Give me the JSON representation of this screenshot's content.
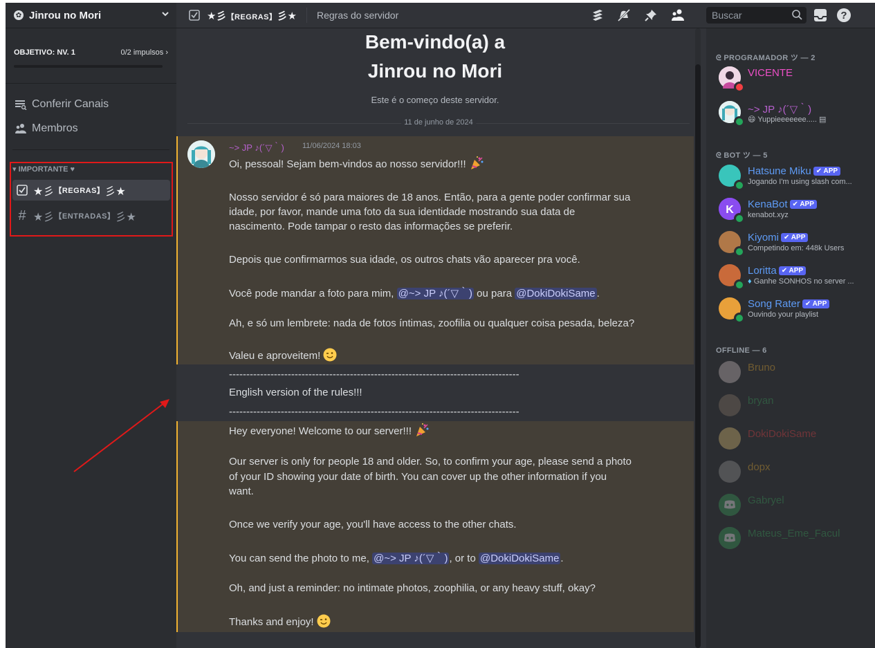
{
  "sidebar": {
    "server_name": "Jinrou no Mori",
    "boost": {
      "goal": "OBJETIVO: NV. 1",
      "count": "0/2 impulsos",
      "progress": 0.0
    },
    "nav": [
      {
        "label": "Conferir Canais",
        "icon": "channel-list-icon"
      },
      {
        "label": "Membros",
        "icon": "members-icon"
      }
    ],
    "category": "▾ IMPORTANTE ♥",
    "channels": [
      {
        "prefix": "★彡",
        "name": "【REGRAS】",
        "suffix": "彡★",
        "icon": "rules-icon",
        "selected": true
      },
      {
        "prefix": "★彡",
        "name": "【ENTRADAS】",
        "suffix": "彡★",
        "icon": "hash-icon",
        "selected": false
      }
    ]
  },
  "topbar": {
    "channel_prefix": "★彡",
    "channel_name": "【REGRAS】",
    "channel_suffix": "彡★",
    "topic": "Regras do servidor",
    "search_placeholder": "Buscar"
  },
  "main": {
    "welcome_line1": "Bem-vindo(a) a",
    "welcome_line2": "Jinrou no Mori",
    "welcome_sub": "Este é o começo deste servidor.",
    "date_divider": "11 de junho de 2024",
    "message": {
      "author": "~> JP ♪(´▽｀)",
      "timestamp": "11/06/2024 18:03",
      "pt": {
        "l1": "Oi, pessoal! Sejam bem-vindos ao nosso servidor!!!",
        "l2": "Nosso servidor é só para maiores de 18 anos. Então, para a gente poder confirmar sua",
        "l3": "idade, por favor, mande uma foto da sua identidade mostrando sua data de",
        "l4": "nascimento. Pode tampar o resto das informações se preferir.",
        "l5": "Depois que confirmarmos sua idade, os outros chats vão aparecer pra você.",
        "l6_pre": "Você pode mandar a foto para mim,",
        "l6_m1": "@~> JP ♪(´▽｀)",
        "l6_mid": "ou para",
        "l6_m2": "@DokiDokiSame",
        "l6_post": ".",
        "l7": "Ah, e só um lembrete: nada de fotos íntimas, zoofilia ou qualquer coisa pesada, beleza?",
        "l8": "Valeu e aproveitem!"
      },
      "divider": "------------------------------------------------------------------------------------",
      "english_header": "English version of the rules!!!",
      "en": {
        "l1": "Hey everyone! Welcome to our server!!!",
        "l2": "Our server is only for people 18 and older. So, to confirm your age, please send a photo",
        "l3": "of your ID showing your date of birth. You can cover up the other information if you",
        "l4": "want.",
        "l5": "Once we verify your age, you'll have access to the other chats.",
        "l6_pre": "You can send the photo to me,",
        "l6_m1": "@~> JP ♪(´▽｀)",
        "l6_mid": ", or to",
        "l6_m2": "@DokiDokiSame",
        "l6_post": ".",
        "l7": "Oh, and just a reminder: no intimate photos, zoophilia, or any heavy stuff, okay?",
        "l8": "Thanks and enjoy!"
      }
    }
  },
  "members": {
    "groups": [
      {
        "label": "ᘓ PROGRAMADOR ツ — 2"
      },
      {
        "label": "ᘓ BOT ツ — 5"
      },
      {
        "label": "OFFLINE — 6"
      }
    ],
    "programadores": [
      {
        "name": "VICENTE",
        "activity": "",
        "color": "#ed4fc7",
        "status": "dnd"
      },
      {
        "name": "~> JP ♪(´▽｀)",
        "activity": "Yuppieeeeeee.....",
        "color": "#b660cd",
        "status": "online"
      }
    ],
    "bots": [
      {
        "name": "Hatsune Miku",
        "tag": "✔ APP",
        "activity": "Jogando I'm using slash com...",
        "color": "#5e9bf5"
      },
      {
        "name": "KenaBot",
        "tag": "✔ APP",
        "activity": "kenabot.xyz",
        "color": "#5e9bf5"
      },
      {
        "name": "Kiyomi",
        "tag": "✔ APP",
        "activity": "Competindo em: 448k Users",
        "color": "#5e9bf5"
      },
      {
        "name": "Loritta",
        "tag": "✔ APP",
        "activity": "Ganhe SONHOS no server ...",
        "color": "#5e9bf5"
      },
      {
        "name": "Song Rater",
        "tag": "✔ APP",
        "activity": "Ouvindo your playlist",
        "color": "#5e9bf5"
      }
    ],
    "offline": [
      {
        "name": "Bruno",
        "color": "#f0b232"
      },
      {
        "name": "bryan",
        "color": "#3ba55d"
      },
      {
        "name": "DokiDokiSame",
        "color": "#ed4245"
      },
      {
        "name": "dopx",
        "color": "#f0b232"
      },
      {
        "name": "Gabryel",
        "color": "#3ba55d"
      },
      {
        "name": "Mateus_Eme_Facul",
        "color": "#3ba55d"
      }
    ]
  },
  "colors": {
    "accent": "#5865f2",
    "highlight": "#f0b232",
    "annotation": "#e11919"
  }
}
